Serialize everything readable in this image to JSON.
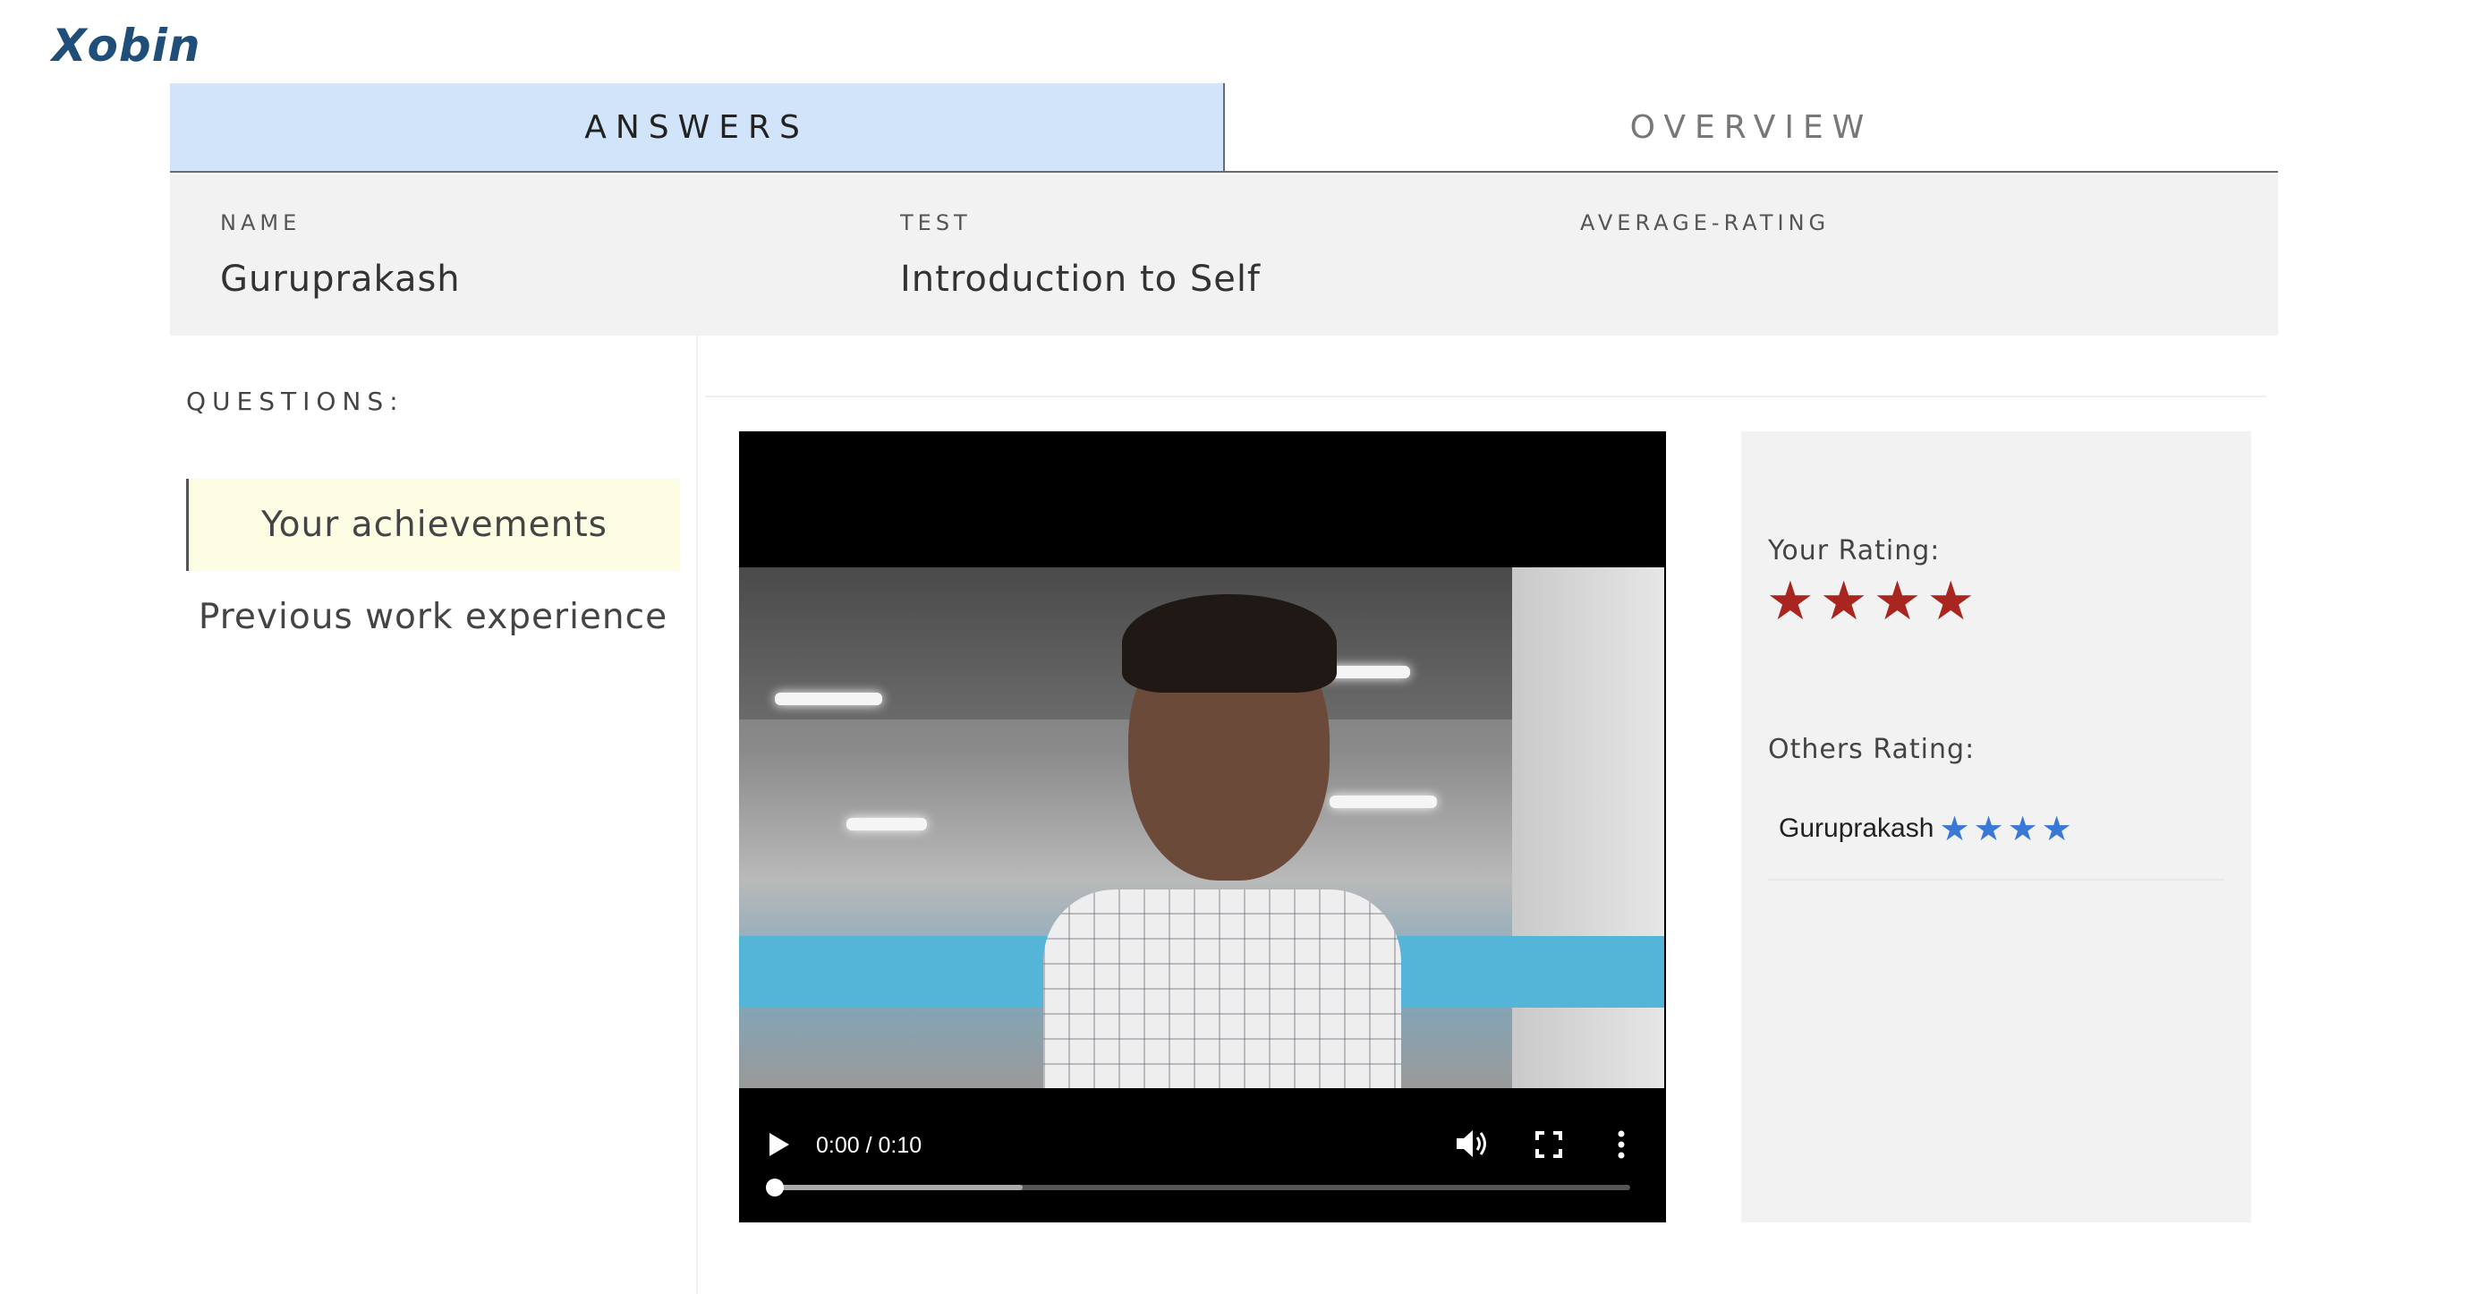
{
  "brand": {
    "logo": "Xobin"
  },
  "tabs": [
    {
      "label": "ANSWERS",
      "active": true
    },
    {
      "label": "OVERVIEW",
      "active": false
    }
  ],
  "info": {
    "name_label": "NAME",
    "name_value": "Guruprakash",
    "test_label": "TEST",
    "test_value": "Introduction to Self",
    "avg_label": "AVERAGE-RATING",
    "avg_value": ""
  },
  "questions": {
    "title": "QUESTIONS:",
    "items": [
      {
        "label": "Your achievements",
        "active": true
      },
      {
        "label": "Previous work experience",
        "active": false
      }
    ]
  },
  "video": {
    "time": "0:00 / 0:10",
    "progress": 0.0,
    "buffered": 0.29
  },
  "rating": {
    "your_label": "Your Rating:",
    "your_stars": 4,
    "others_label": "Others Rating:",
    "others": [
      {
        "name": "Guruprakash",
        "stars": 4
      }
    ]
  },
  "colors": {
    "active_tab": "#d2e4f9",
    "active_question": "#fdfde4",
    "your_star": "#a8261f",
    "other_star": "#3a78d8",
    "logo": "#1f4e79"
  }
}
